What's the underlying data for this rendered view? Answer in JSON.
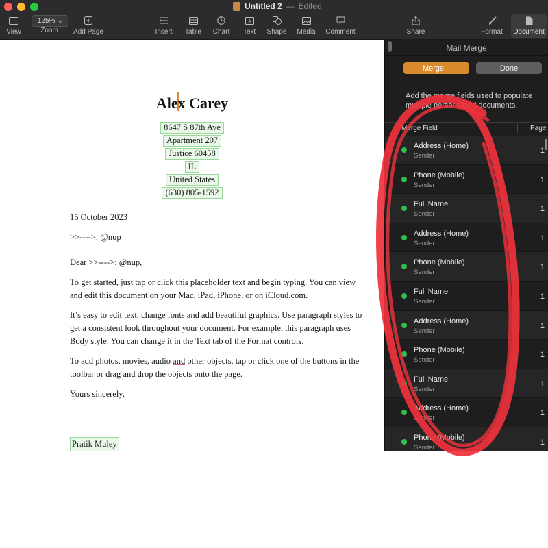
{
  "window": {
    "title": "Untitled 2",
    "separator": "—",
    "state": "Edited"
  },
  "toolbar": {
    "view": "View",
    "zoom_value": "125%",
    "zoom": "Zoom",
    "add_page": "Add Page",
    "insert": "Insert",
    "table": "Table",
    "chart": "Chart",
    "text": "Text",
    "shape": "Shape",
    "media": "Media",
    "comment": "Comment",
    "share": "Share",
    "format": "Format",
    "document": "Document"
  },
  "document": {
    "sender_name": "Alex Carey",
    "address_lines": [
      "8647 S 87th Ave",
      "Apartment 207",
      "Justice 60458",
      "IL",
      "United States",
      "(630) 805-1592"
    ],
    "date": "15 October 2023",
    "recipient_line": ">>---->: @nup",
    "salutation": "Dear >>---->: @nup,",
    "para1": "To get started, just tap or click this placeholder text and begin typing. You can view and edit this document on your Mac, iPad, iPhone, or on iCloud.com.",
    "para2_a": "It’s easy to edit text, change fonts ",
    "para2_and": "and",
    "para2_b": " add beautiful graphics. Use paragraph styles to get a consistent look throughout your document. For example, this paragraph uses Body style. You can change it in the Text tab of the Format controls.",
    "para3_a": "To add photos, movies, audio ",
    "para3_and": "and",
    "para3_b": " other objects, tap or click one of the buttons in the toolbar or drag and drop the objects onto the page.",
    "closing": "Yours sincerely,",
    "signature": "Pratik Muley"
  },
  "mail_merge": {
    "title": "Mail Merge",
    "merge_button": "Merge...",
    "done_button": "Done",
    "description": "Add the merge fields used to populate multiple personalised documents.",
    "col_field": "Merge Field",
    "col_page": "Page",
    "rows": [
      {
        "name": "Address (Home)",
        "source": "Sender",
        "page": "1"
      },
      {
        "name": "Phone (Mobile)",
        "source": "Sender",
        "page": "1"
      },
      {
        "name": "Full Name",
        "source": "Sender",
        "page": "1"
      },
      {
        "name": "Address (Home)",
        "source": "Sender",
        "page": "1"
      },
      {
        "name": "Phone (Mobile)",
        "source": "Sender",
        "page": "1"
      },
      {
        "name": "Full Name",
        "source": "Sender",
        "page": "1"
      },
      {
        "name": "Address (Home)",
        "source": "Sender",
        "page": "1"
      },
      {
        "name": "Phone (Mobile)",
        "source": "Sender",
        "page": "1"
      },
      {
        "name": "Full Name",
        "source": "Sender",
        "page": "1"
      },
      {
        "name": "Address (Home)",
        "source": "Sender",
        "page": "1"
      },
      {
        "name": "Phone (Mobile)",
        "source": "Sender",
        "page": "1"
      }
    ]
  },
  "colors": {
    "accent": "#d98a2a",
    "field_dot": "#2ec04a",
    "annotation": "#f0323c"
  }
}
